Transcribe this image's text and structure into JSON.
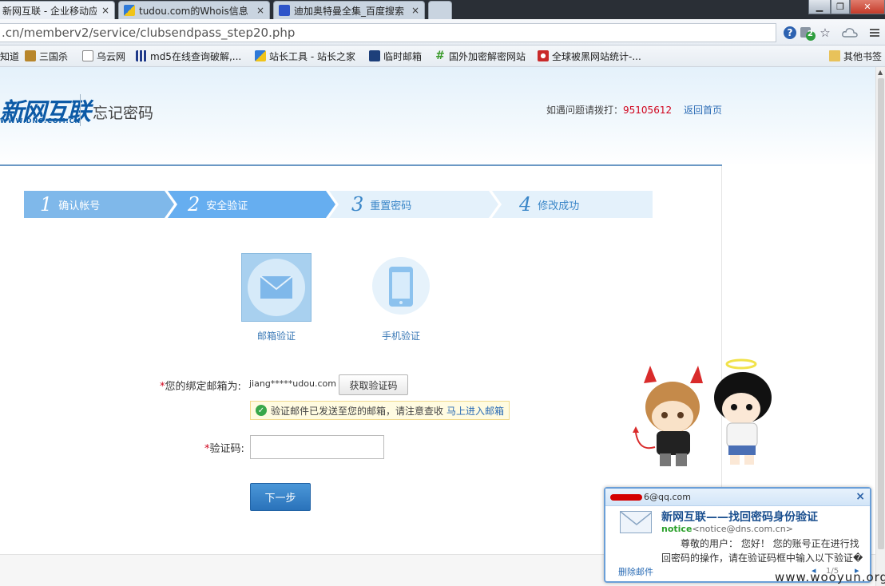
{
  "browser": {
    "tabs": [
      {
        "label": "新网互联 - 企业移动应用服",
        "active": true
      },
      {
        "label": "tudou.com的Whois信息",
        "active": false
      },
      {
        "label": "迪加奥特曼全集_百度搜索",
        "active": false
      }
    ],
    "tab_close_glyph": "×",
    "url": ".cn/memberv2/service/clubsendpass_step20.php",
    "extension_badge": "2",
    "bookmarks": [
      {
        "label": "知道",
        "icon": "bookmark-icon"
      },
      {
        "label": "三国杀",
        "icon": "sanguosha-icon"
      },
      {
        "label": "乌云网",
        "icon": "page-icon"
      },
      {
        "label": "md5在线查询破解,...",
        "icon": "grid-icon"
      },
      {
        "label": "站长工具 - 站长之家",
        "icon": "chinaz-icon"
      },
      {
        "label": "临时邮箱",
        "icon": "mail-icon"
      },
      {
        "label": "国外加密解密网站",
        "icon": "hash-icon"
      },
      {
        "label": "全球被黑网站统计-...",
        "icon": "shield-icon"
      }
    ],
    "other_bookmarks": "其他书签"
  },
  "header": {
    "logo_text": "新网互联",
    "logo_sub": "WWW.DNS.COM.CN",
    "title": "忘记密码",
    "hotline_label": "如遇问题请拨打：",
    "hotline_number": "95105612",
    "home_link": "返回首页"
  },
  "steps": [
    {
      "num": "1",
      "label": "确认帐号",
      "state": "done"
    },
    {
      "num": "2",
      "label": "安全验证",
      "state": "current"
    },
    {
      "num": "3",
      "label": "重置密码",
      "state": "todo"
    },
    {
      "num": "4",
      "label": "修改成功",
      "state": "todo"
    }
  ],
  "options": {
    "email_label": "邮箱验证",
    "phone_label": "手机验证"
  },
  "form": {
    "required_mark": "*",
    "email_label": "您的绑定邮箱为:",
    "email_value": "jiang*****udou.com",
    "get_code_button": "获取验证码",
    "sent_notice": "验证邮件已发送至您的邮箱，请注意查收",
    "sent_link": "马上进入邮箱",
    "code_label": "验证码:",
    "code_value": "",
    "next_button": "下一步"
  },
  "notification": {
    "account_suffix": "6@qq.com",
    "close_glyph": "×",
    "title": "新网互联——找回密码身份验证",
    "from_name": "notice",
    "from_addr": "<notice@dns.com.cn>",
    "body_line1": "尊敬的用户： 您好！ 您的账号正在进行找",
    "body_line2": "回密码的操作，请在验证码框中输入以下验证�",
    "delete_link": "删除邮件",
    "page": "1/5"
  },
  "watermark": "www.wooyun.org",
  "colors": {
    "brand_blue": "#0c5aa6",
    "step_done": "#7fb8ea",
    "step_current": "#66aef0",
    "step_todo": "#e4f1fb",
    "hotline_red": "#d0021b",
    "link_blue": "#2b6cb5"
  }
}
